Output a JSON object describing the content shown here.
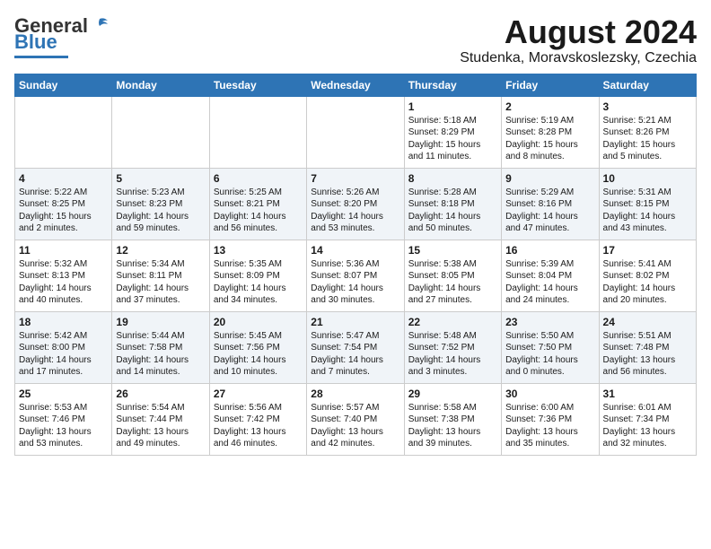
{
  "logo": {
    "general": "General",
    "blue": "Blue"
  },
  "title": "August 2024",
  "subtitle": "Studenka, Moravskoslezsky, Czechia",
  "weekdays": [
    "Sunday",
    "Monday",
    "Tuesday",
    "Wednesday",
    "Thursday",
    "Friday",
    "Saturday"
  ],
  "weeks": [
    [
      {
        "day": "",
        "info": ""
      },
      {
        "day": "",
        "info": ""
      },
      {
        "day": "",
        "info": ""
      },
      {
        "day": "",
        "info": ""
      },
      {
        "day": "1",
        "info": "Sunrise: 5:18 AM\nSunset: 8:29 PM\nDaylight: 15 hours\nand 11 minutes."
      },
      {
        "day": "2",
        "info": "Sunrise: 5:19 AM\nSunset: 8:28 PM\nDaylight: 15 hours\nand 8 minutes."
      },
      {
        "day": "3",
        "info": "Sunrise: 5:21 AM\nSunset: 8:26 PM\nDaylight: 15 hours\nand 5 minutes."
      }
    ],
    [
      {
        "day": "4",
        "info": "Sunrise: 5:22 AM\nSunset: 8:25 PM\nDaylight: 15 hours\nand 2 minutes."
      },
      {
        "day": "5",
        "info": "Sunrise: 5:23 AM\nSunset: 8:23 PM\nDaylight: 14 hours\nand 59 minutes."
      },
      {
        "day": "6",
        "info": "Sunrise: 5:25 AM\nSunset: 8:21 PM\nDaylight: 14 hours\nand 56 minutes."
      },
      {
        "day": "7",
        "info": "Sunrise: 5:26 AM\nSunset: 8:20 PM\nDaylight: 14 hours\nand 53 minutes."
      },
      {
        "day": "8",
        "info": "Sunrise: 5:28 AM\nSunset: 8:18 PM\nDaylight: 14 hours\nand 50 minutes."
      },
      {
        "day": "9",
        "info": "Sunrise: 5:29 AM\nSunset: 8:16 PM\nDaylight: 14 hours\nand 47 minutes."
      },
      {
        "day": "10",
        "info": "Sunrise: 5:31 AM\nSunset: 8:15 PM\nDaylight: 14 hours\nand 43 minutes."
      }
    ],
    [
      {
        "day": "11",
        "info": "Sunrise: 5:32 AM\nSunset: 8:13 PM\nDaylight: 14 hours\nand 40 minutes."
      },
      {
        "day": "12",
        "info": "Sunrise: 5:34 AM\nSunset: 8:11 PM\nDaylight: 14 hours\nand 37 minutes."
      },
      {
        "day": "13",
        "info": "Sunrise: 5:35 AM\nSunset: 8:09 PM\nDaylight: 14 hours\nand 34 minutes."
      },
      {
        "day": "14",
        "info": "Sunrise: 5:36 AM\nSunset: 8:07 PM\nDaylight: 14 hours\nand 30 minutes."
      },
      {
        "day": "15",
        "info": "Sunrise: 5:38 AM\nSunset: 8:05 PM\nDaylight: 14 hours\nand 27 minutes."
      },
      {
        "day": "16",
        "info": "Sunrise: 5:39 AM\nSunset: 8:04 PM\nDaylight: 14 hours\nand 24 minutes."
      },
      {
        "day": "17",
        "info": "Sunrise: 5:41 AM\nSunset: 8:02 PM\nDaylight: 14 hours\nand 20 minutes."
      }
    ],
    [
      {
        "day": "18",
        "info": "Sunrise: 5:42 AM\nSunset: 8:00 PM\nDaylight: 14 hours\nand 17 minutes."
      },
      {
        "day": "19",
        "info": "Sunrise: 5:44 AM\nSunset: 7:58 PM\nDaylight: 14 hours\nand 14 minutes."
      },
      {
        "day": "20",
        "info": "Sunrise: 5:45 AM\nSunset: 7:56 PM\nDaylight: 14 hours\nand 10 minutes."
      },
      {
        "day": "21",
        "info": "Sunrise: 5:47 AM\nSunset: 7:54 PM\nDaylight: 14 hours\nand 7 minutes."
      },
      {
        "day": "22",
        "info": "Sunrise: 5:48 AM\nSunset: 7:52 PM\nDaylight: 14 hours\nand 3 minutes."
      },
      {
        "day": "23",
        "info": "Sunrise: 5:50 AM\nSunset: 7:50 PM\nDaylight: 14 hours\nand 0 minutes."
      },
      {
        "day": "24",
        "info": "Sunrise: 5:51 AM\nSunset: 7:48 PM\nDaylight: 13 hours\nand 56 minutes."
      }
    ],
    [
      {
        "day": "25",
        "info": "Sunrise: 5:53 AM\nSunset: 7:46 PM\nDaylight: 13 hours\nand 53 minutes."
      },
      {
        "day": "26",
        "info": "Sunrise: 5:54 AM\nSunset: 7:44 PM\nDaylight: 13 hours\nand 49 minutes."
      },
      {
        "day": "27",
        "info": "Sunrise: 5:56 AM\nSunset: 7:42 PM\nDaylight: 13 hours\nand 46 minutes."
      },
      {
        "day": "28",
        "info": "Sunrise: 5:57 AM\nSunset: 7:40 PM\nDaylight: 13 hours\nand 42 minutes."
      },
      {
        "day": "29",
        "info": "Sunrise: 5:58 AM\nSunset: 7:38 PM\nDaylight: 13 hours\nand 39 minutes."
      },
      {
        "day": "30",
        "info": "Sunrise: 6:00 AM\nSunset: 7:36 PM\nDaylight: 13 hours\nand 35 minutes."
      },
      {
        "day": "31",
        "info": "Sunrise: 6:01 AM\nSunset: 7:34 PM\nDaylight: 13 hours\nand 32 minutes."
      }
    ]
  ]
}
